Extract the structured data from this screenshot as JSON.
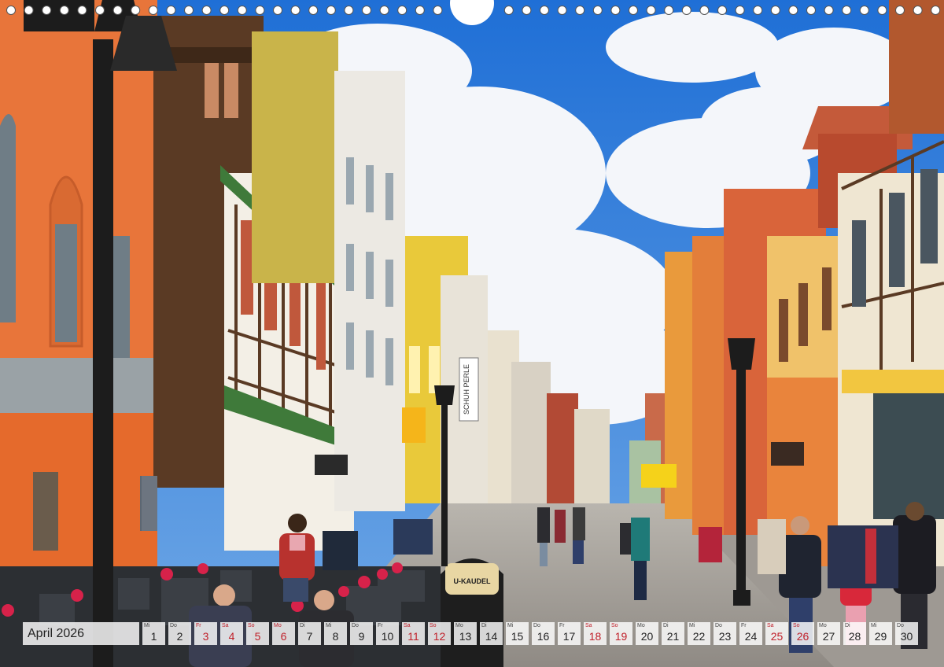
{
  "calendar": {
    "month_label": "April 2026",
    "days": [
      {
        "num": "1",
        "wd": "Mi",
        "weekend": false
      },
      {
        "num": "2",
        "wd": "Do",
        "weekend": false
      },
      {
        "num": "3",
        "wd": "Fr",
        "weekend": true
      },
      {
        "num": "4",
        "wd": "Sa",
        "weekend": true
      },
      {
        "num": "5",
        "wd": "So",
        "weekend": true
      },
      {
        "num": "6",
        "wd": "Mo",
        "weekend": true
      },
      {
        "num": "7",
        "wd": "Di",
        "weekend": false
      },
      {
        "num": "8",
        "wd": "Mi",
        "weekend": false
      },
      {
        "num": "9",
        "wd": "Do",
        "weekend": false
      },
      {
        "num": "10",
        "wd": "Fr",
        "weekend": false
      },
      {
        "num": "11",
        "wd": "Sa",
        "weekend": true
      },
      {
        "num": "12",
        "wd": "So",
        "weekend": true
      },
      {
        "num": "13",
        "wd": "Mo",
        "weekend": false
      },
      {
        "num": "14",
        "wd": "Di",
        "weekend": false
      },
      {
        "num": "15",
        "wd": "Mi",
        "weekend": false
      },
      {
        "num": "16",
        "wd": "Do",
        "weekend": false
      },
      {
        "num": "17",
        "wd": "Fr",
        "weekend": false
      },
      {
        "num": "18",
        "wd": "Sa",
        "weekend": true
      },
      {
        "num": "19",
        "wd": "So",
        "weekend": true
      },
      {
        "num": "20",
        "wd": "Mo",
        "weekend": false
      },
      {
        "num": "21",
        "wd": "Di",
        "weekend": false
      },
      {
        "num": "22",
        "wd": "Mi",
        "weekend": false
      },
      {
        "num": "23",
        "wd": "Do",
        "weekend": false
      },
      {
        "num": "24",
        "wd": "Fr",
        "weekend": false
      },
      {
        "num": "25",
        "wd": "Sa",
        "weekend": true
      },
      {
        "num": "26",
        "wd": "So",
        "weekend": true
      },
      {
        "num": "27",
        "wd": "Mo",
        "weekend": false
      },
      {
        "num": "28",
        "wd": "Di",
        "weekend": false
      },
      {
        "num": "29",
        "wd": "Mi",
        "weekend": false
      },
      {
        "num": "30",
        "wd": "Do",
        "weekend": false
      }
    ]
  },
  "signs": {
    "schuh_perle": "SCHUH PERLE",
    "menu_board": "U-KAUDEL"
  },
  "colors": {
    "sky": "#2a78d8",
    "weekend_red": "#c0202a",
    "orange_house": "#e8753a"
  }
}
